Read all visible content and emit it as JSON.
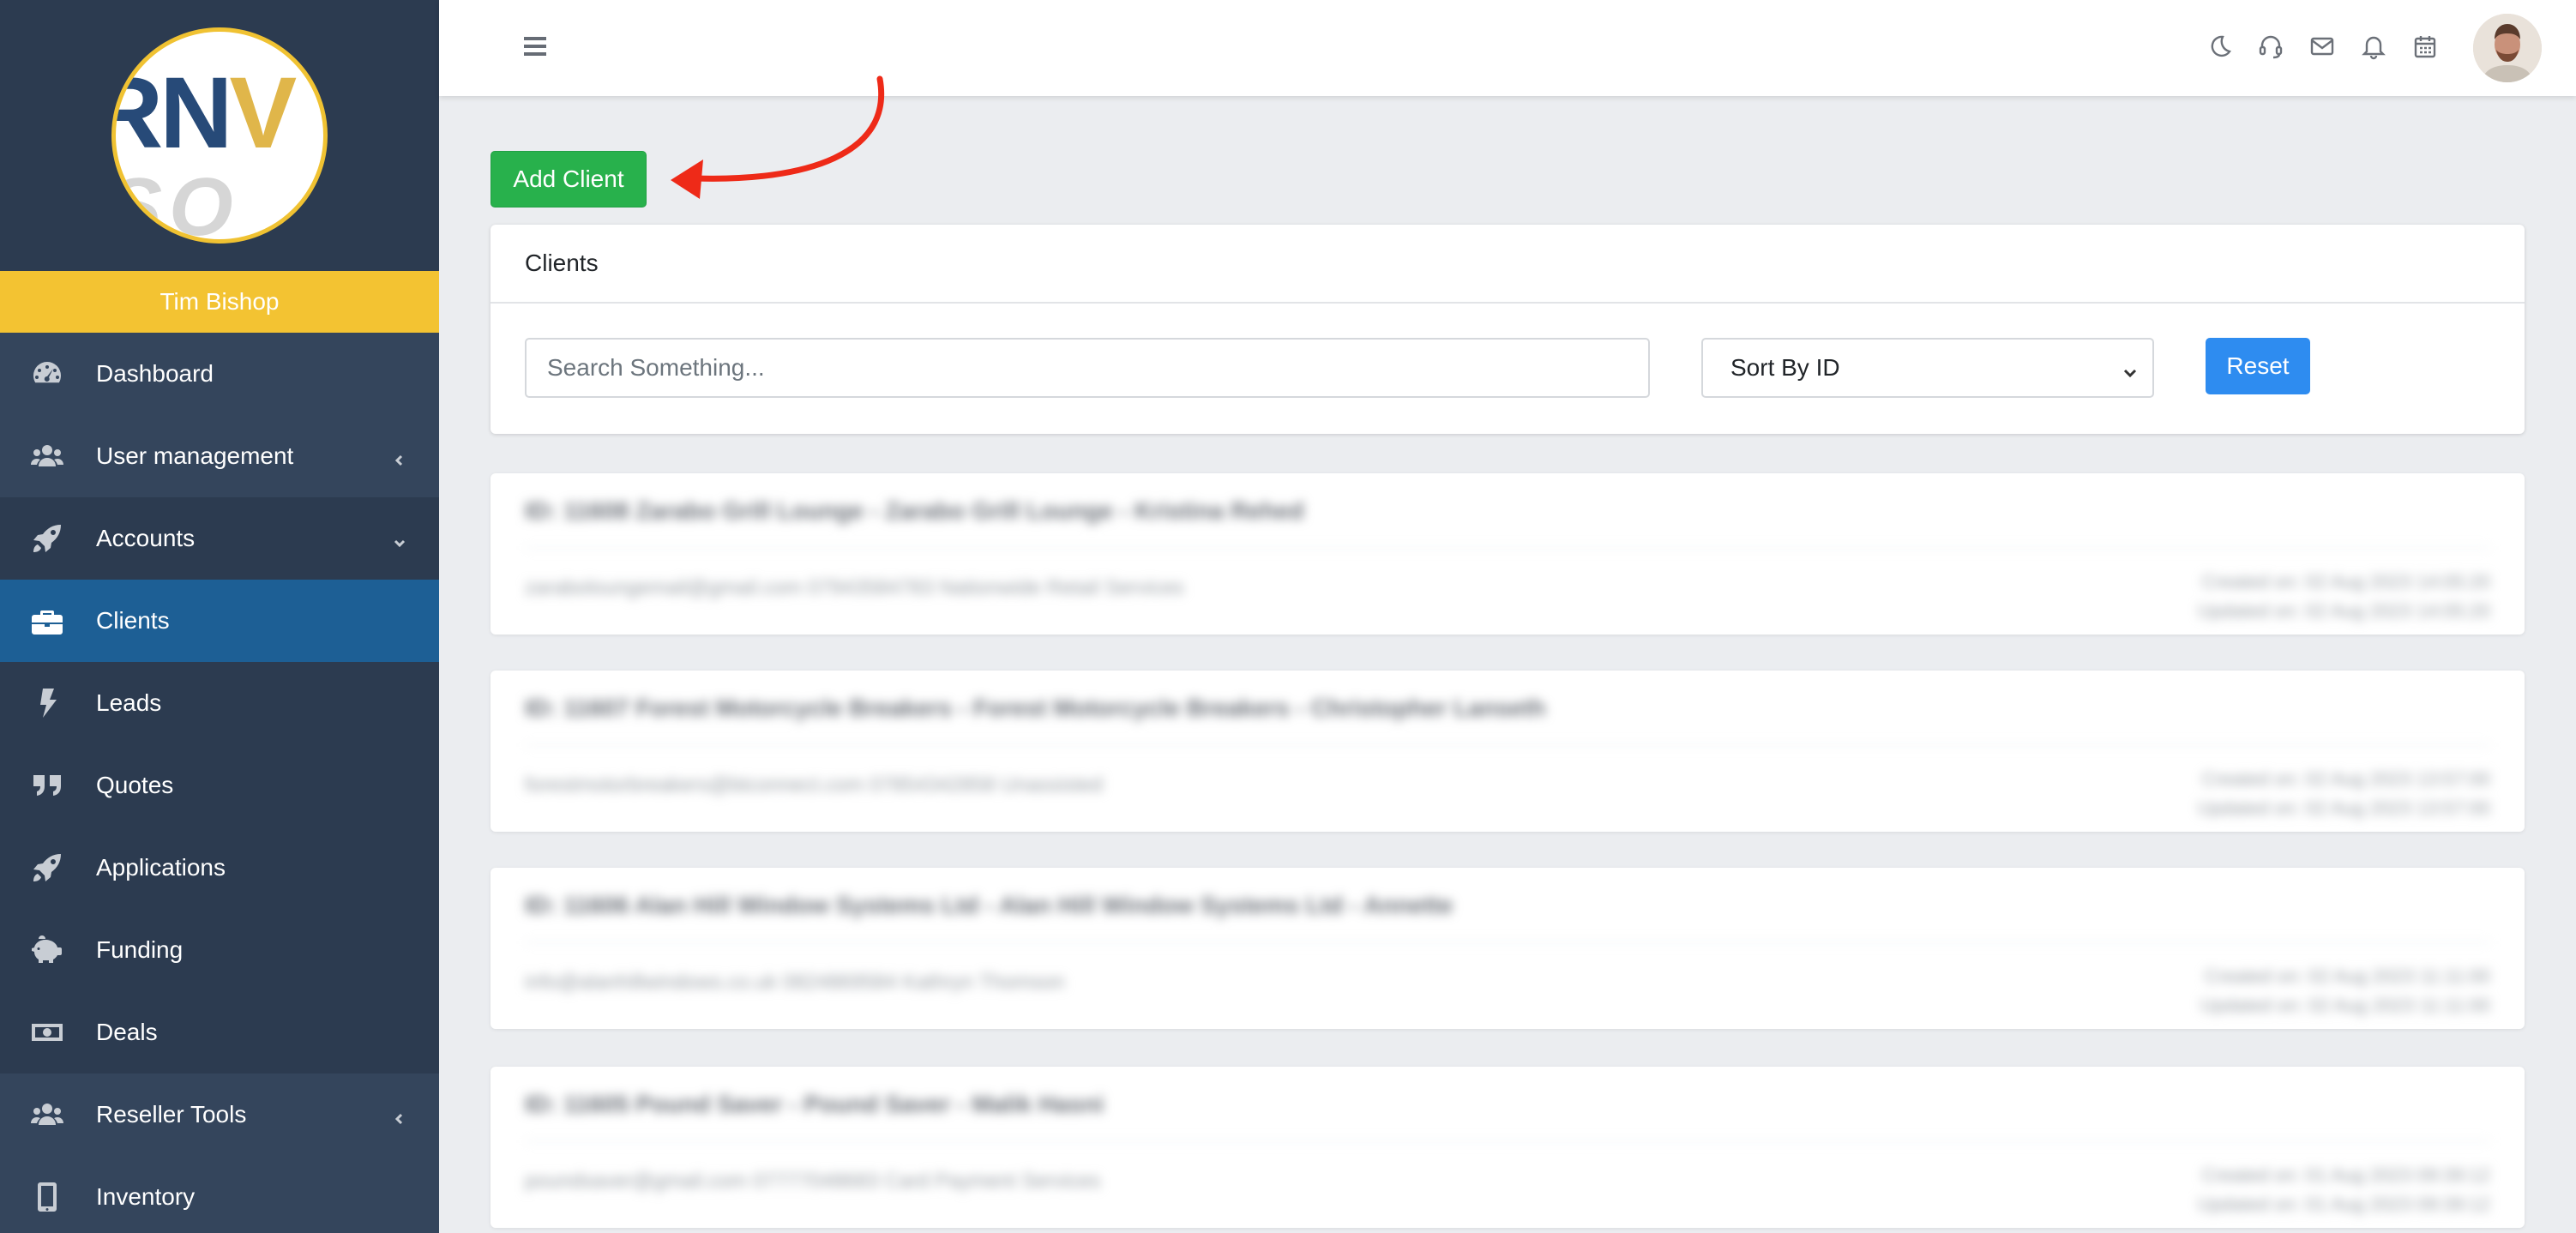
{
  "sidebar": {
    "logo_text_main": "RNV",
    "logo_text_sub": "SO",
    "user_name": "Tim Bishop",
    "items": [
      {
        "label": "Dashboard",
        "icon": "gauge-icon",
        "chevron": ""
      },
      {
        "label": "User management",
        "icon": "users-icon",
        "chevron": "chevron-left"
      },
      {
        "label": "Accounts",
        "icon": "rocket-icon",
        "chevron": "chevron-down"
      },
      {
        "label": "Clients",
        "icon": "briefcase-icon",
        "chevron": ""
      },
      {
        "label": "Leads",
        "icon": "bolt-icon",
        "chevron": ""
      },
      {
        "label": "Quotes",
        "icon": "quote-icon",
        "chevron": ""
      },
      {
        "label": "Applications",
        "icon": "rocket-icon",
        "chevron": ""
      },
      {
        "label": "Funding",
        "icon": "piggy-bank-icon",
        "chevron": ""
      },
      {
        "label": "Deals",
        "icon": "money-icon",
        "chevron": ""
      },
      {
        "label": "Reseller Tools",
        "icon": "users-icon",
        "chevron": "chevron-left"
      },
      {
        "label": "Inventory",
        "icon": "mobile-icon",
        "chevron": ""
      }
    ],
    "active_item": "Clients"
  },
  "topbar": {
    "icons": [
      "moon-icon",
      "headset-icon",
      "envelope-icon",
      "bell-icon",
      "calendar-icon"
    ]
  },
  "toolbar": {
    "add_client_label": "Add Client"
  },
  "clients_card": {
    "title": "Clients",
    "search_placeholder": "Search Something...",
    "sort_selected": "Sort By ID",
    "reset_label": "Reset"
  },
  "records": [
    {
      "title": "ID: 11608 Zarabo Grill Lounge - Zarabo Grill Lounge - Kristina Rehed",
      "contacts": "zaraboloungemail@gmail.com  07943584783  Nationwide Retail Services",
      "created": "Created on: 02 Aug 2023 14:05:20",
      "updated": "Updated on: 02 Aug 2023 14:05:20"
    },
    {
      "title": "ID: 11607 Forest Motorcycle Breakers - Forest Motorcycle Breakers - Christopher Lanseth",
      "contacts": "forestmotorbreakers@btconnect.com  07854342858  Unassisted",
      "created": "Created on: 02 Aug 2023 13:57:00",
      "updated": "Updated on: 02 Aug 2023 13:57:00"
    },
    {
      "title": "ID: 11606 Alan Hill Window Systems Ltd - Alan Hill Window Systems Ltd - Annette",
      "contacts": "info@alanhillwindows.co.uk  0824869584  Kathryn Thomson",
      "created": "Created on: 02 Aug 2023 11:11:00",
      "updated": "Updated on: 02 Aug 2023 11:11:00"
    },
    {
      "title": "ID: 11605 Pound Saver - Pound Saver - Malik Hasni",
      "contacts": "poundsaver@gmail.com  07777048683  Card Payment Services",
      "created": "Created on: 01 Aug 2023 09:39:12",
      "updated": "Updated on: 01 Aug 2023 09:39:12"
    }
  ],
  "colors": {
    "sidebar_bg": "#2c3b50",
    "sidebar_active": "#1d5f95",
    "user_bar": "#f3c332",
    "add_button": "#28b14c",
    "reset_button": "#2e8cf0",
    "annotation_arrow": "#ee2a18"
  }
}
